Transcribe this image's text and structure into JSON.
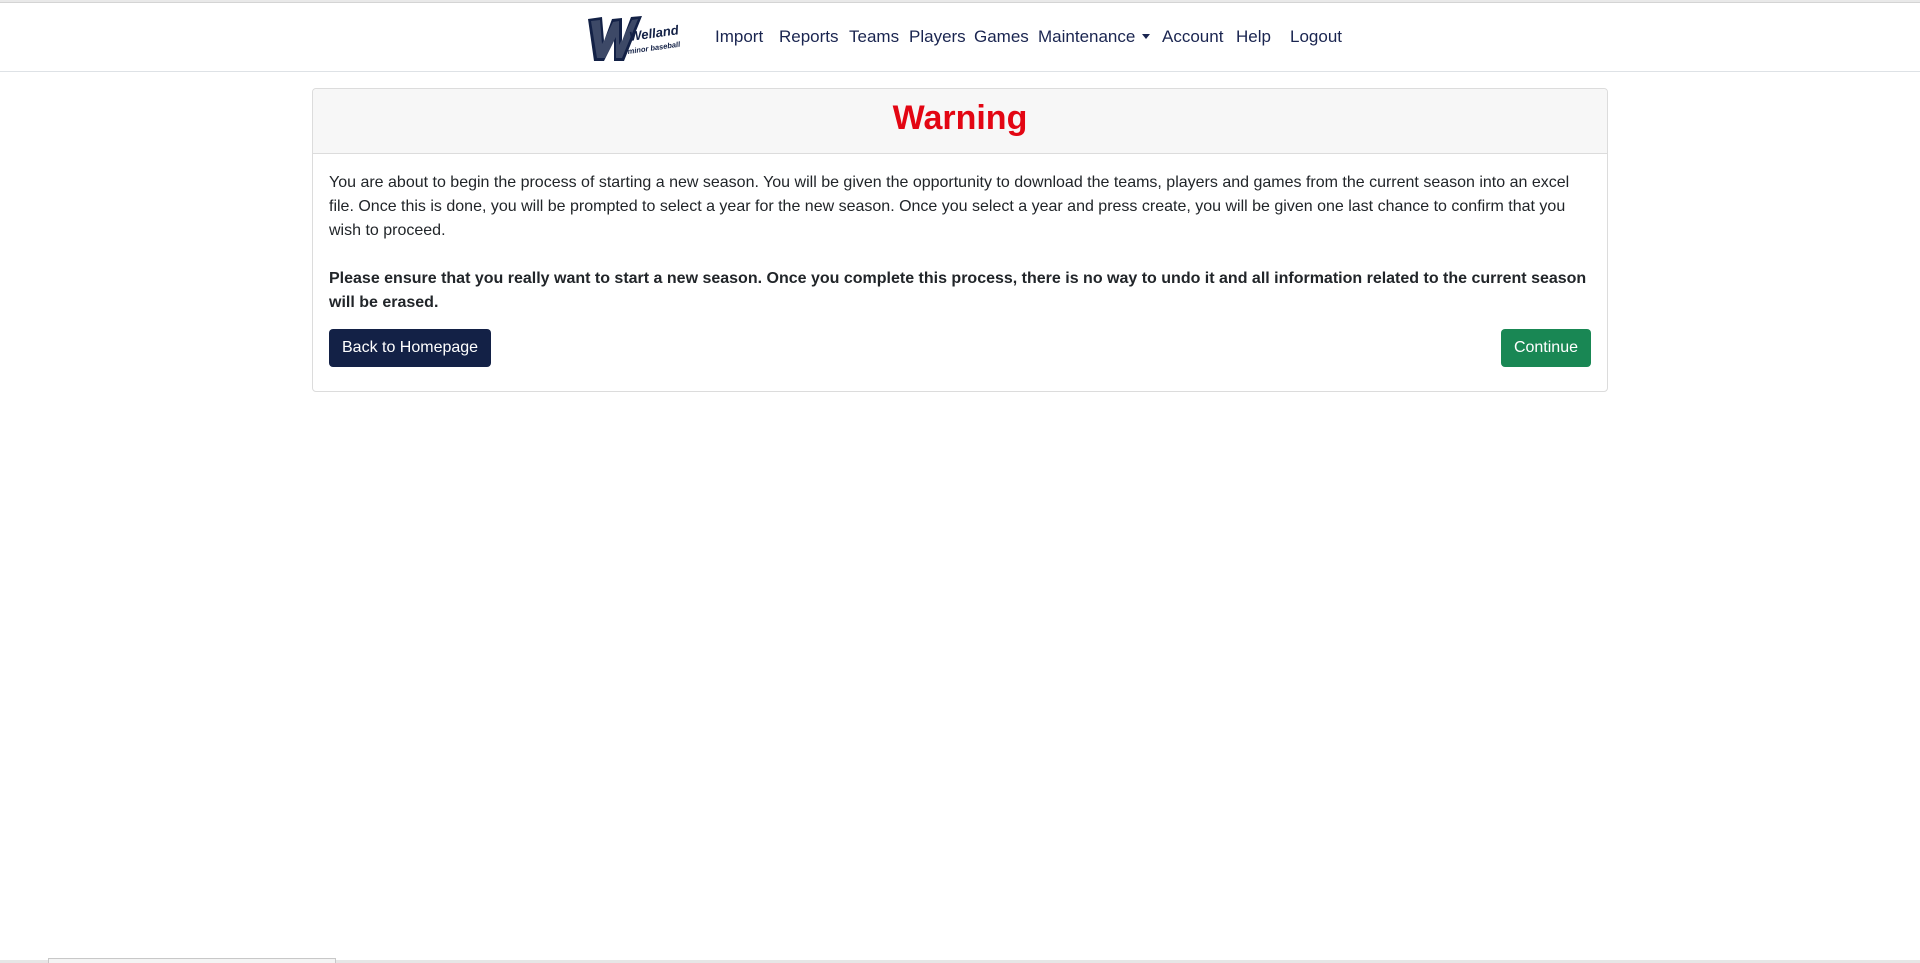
{
  "nav": {
    "logo": {
      "text_main": "Welland",
      "text_sub": "minor baseball",
      "color": "#132146"
    },
    "items": [
      {
        "label": "Import"
      },
      {
        "label": "Reports"
      },
      {
        "label": "Teams"
      },
      {
        "label": "Players"
      },
      {
        "label": "Games"
      },
      {
        "label": "Maintenance",
        "dropdown": true
      },
      {
        "label": "Account"
      },
      {
        "label": "Help"
      },
      {
        "label": "Logout"
      }
    ],
    "link_color": "#1a2550"
  },
  "card": {
    "title": "Warning",
    "title_color": "#e30613",
    "paragraph": "You are about to begin the process of starting a new season. You will be given the opportunity to download the teams, players and games from the current season into an excel file. Once this is done, you will be prompted to select a year for the new season. Once you select a year and press create, you will be given one last chance to confirm that you wish to proceed.",
    "warning_text": "Please ensure that you really want to start a new season. Once you complete this process, there is no way to undo it and all information related to the current season will be erased.",
    "back_button": "Back to Homepage",
    "continue_button": "Continue",
    "back_color": "#132146",
    "continue_color": "#198754"
  }
}
